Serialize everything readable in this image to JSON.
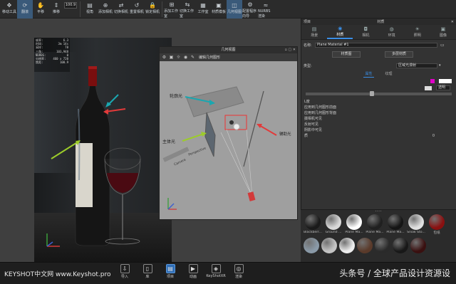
{
  "toolbar": {
    "buttons": [
      {
        "label": "移动工具",
        "icon": "move-icon"
      },
      {
        "label": "翻滚",
        "icon": "tumble-icon"
      },
      {
        "label": "平移",
        "icon": "pan-icon"
      },
      {
        "label": "推移",
        "icon": "dolly-icon"
      },
      {
        "label": "视角",
        "icon": "perspective-icon"
      },
      {
        "label": "添加相机",
        "icon": "add-camera-icon"
      },
      {
        "label": "切换相机",
        "icon": "switch-camera-icon"
      },
      {
        "label": "重置相机",
        "icon": "reset-camera-icon"
      },
      {
        "label": "锁定相机",
        "icon": "lock-camera-icon"
      },
      {
        "label": "添加工作室",
        "icon": "add-studio-icon"
      },
      {
        "label": "切换工作室",
        "icon": "switch-studio-icon"
      },
      {
        "label": "工作室",
        "icon": "studio-icon"
      },
      {
        "label": "材质模板",
        "icon": "material-template-icon"
      },
      {
        "label": "几何视图",
        "icon": "geometry-view-icon"
      },
      {
        "label": "配置程序向导",
        "icon": "configurator-icon"
      },
      {
        "label": "NURBS渲染",
        "icon": "nurbs-icon"
      }
    ],
    "fov_value": "100.9"
  },
  "render_stats": {
    "rows": [
      {
        "k": "帧率:",
        "v": "6.3"
      },
      {
        "k": "时间:",
        "v": "3m 14s"
      },
      {
        "k": "采样:",
        "v": "78"
      },
      {
        "k": "三角:",
        "v": "103,948"
      },
      {
        "k": "NURBS:",
        "v": "0"
      },
      {
        "k": "分辨率:",
        "v": "460 x 720"
      },
      {
        "k": "焦距:",
        "v": "100.9"
      }
    ]
  },
  "geometry_view": {
    "title": "几何视图",
    "toolbar_label": "编辑几何图形",
    "labels": {
      "rim_light": "轮廓光",
      "key_light": "主体光",
      "fill_light": "辅助光",
      "perspective": "Perspective",
      "camera": "Camera"
    }
  },
  "panel": {
    "title": "项目",
    "subtitle": "材质",
    "tabs": [
      {
        "label": "场景",
        "icon": "scene-icon"
      },
      {
        "label": "材质",
        "icon": "material-icon"
      },
      {
        "label": "相机",
        "icon": "camera-icon"
      },
      {
        "label": "环境",
        "icon": "environment-icon"
      },
      {
        "label": "照明",
        "icon": "lighting-icon"
      },
      {
        "label": "图像",
        "icon": "image-icon"
      }
    ],
    "name_label": "名称:",
    "name_value": "Plane Material #1",
    "material_graph_btn": "材质图",
    "multi_material_btn": "多层材质",
    "type_label": "类型:",
    "type_value": "区域光漫射",
    "sub_tabs": [
      "属性",
      "纹理"
    ],
    "transparent_label": "透明",
    "list_header": "L度",
    "list_items": [
      "应用到几何图形前面",
      "应用到几何图形背面",
      "摄相机可见",
      "反射可见",
      "阴影中可见",
      "质"
    ],
    "quality_value": "0"
  },
  "library": {
    "swatches_row1": [
      {
        "label": "Blackberr...",
        "color": "#1a1a1a"
      },
      {
        "label": "Ground ...",
        "color": "#d9d9d9"
      },
      {
        "label": "Plane Ma...",
        "color": "#ffffff"
      },
      {
        "label": "Plane Ma...",
        "color": "#202020"
      },
      {
        "label": "Plane Ma...",
        "color": "#151515"
      },
      {
        "label": "Snow Sto...",
        "color": "#e0e0e0"
      },
      {
        "label": "包纸",
        "color": "#8a1010"
      }
    ],
    "swatches_row2": [
      {
        "color": "#8a9aa8"
      },
      {
        "color": "#c4c4c4"
      },
      {
        "color": "#ededed"
      },
      {
        "color": "#5a3a2a"
      },
      {
        "color": "#2a2a2a"
      },
      {
        "color": "#181818"
      },
      {
        "color": "#3a1010"
      }
    ]
  },
  "bottom": {
    "brand": "KEYSHOT中文网  www.Keyshot.pro",
    "buttons": [
      {
        "label": "导入",
        "icon": "import-icon"
      },
      {
        "label": "库",
        "icon": "library-icon"
      },
      {
        "label": "项目",
        "icon": "project-icon"
      },
      {
        "label": "动画",
        "icon": "animation-icon"
      },
      {
        "label": "KeyShotXR",
        "icon": "keyshotxr-icon"
      },
      {
        "label": "渲染",
        "icon": "render-icon"
      }
    ],
    "watermark": "头条号 / 全球产品设计资源设"
  },
  "colors": {
    "accent": "#3a8ee6",
    "arrow_cyan": "#1aa7b0",
    "arrow_red": "#e23a3a",
    "arrow_green": "#9ccc2a"
  }
}
